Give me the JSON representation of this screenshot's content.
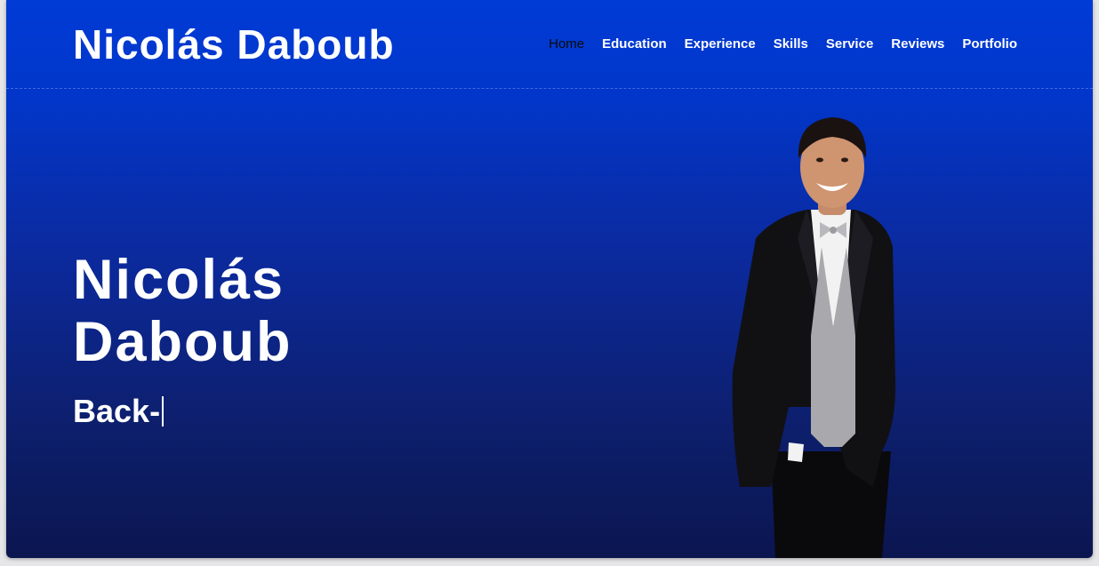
{
  "header": {
    "brand": "Nicolás Daboub",
    "nav": [
      {
        "label": "Home",
        "active": true
      },
      {
        "label": "Education"
      },
      {
        "label": "Experience"
      },
      {
        "label": "Skills"
      },
      {
        "label": "Service"
      },
      {
        "label": "Reviews"
      },
      {
        "label": "Portfolio"
      }
    ]
  },
  "hero": {
    "title_line1": "Nicolás",
    "title_line2": "Daboub",
    "typed_text": "Back-"
  },
  "colors": {
    "brand_blue": "#003bd6",
    "deep_navy": "#0b1650",
    "active_nav": "#0a0a0a"
  },
  "icons": {
    "portrait": "portrait-photo"
  }
}
